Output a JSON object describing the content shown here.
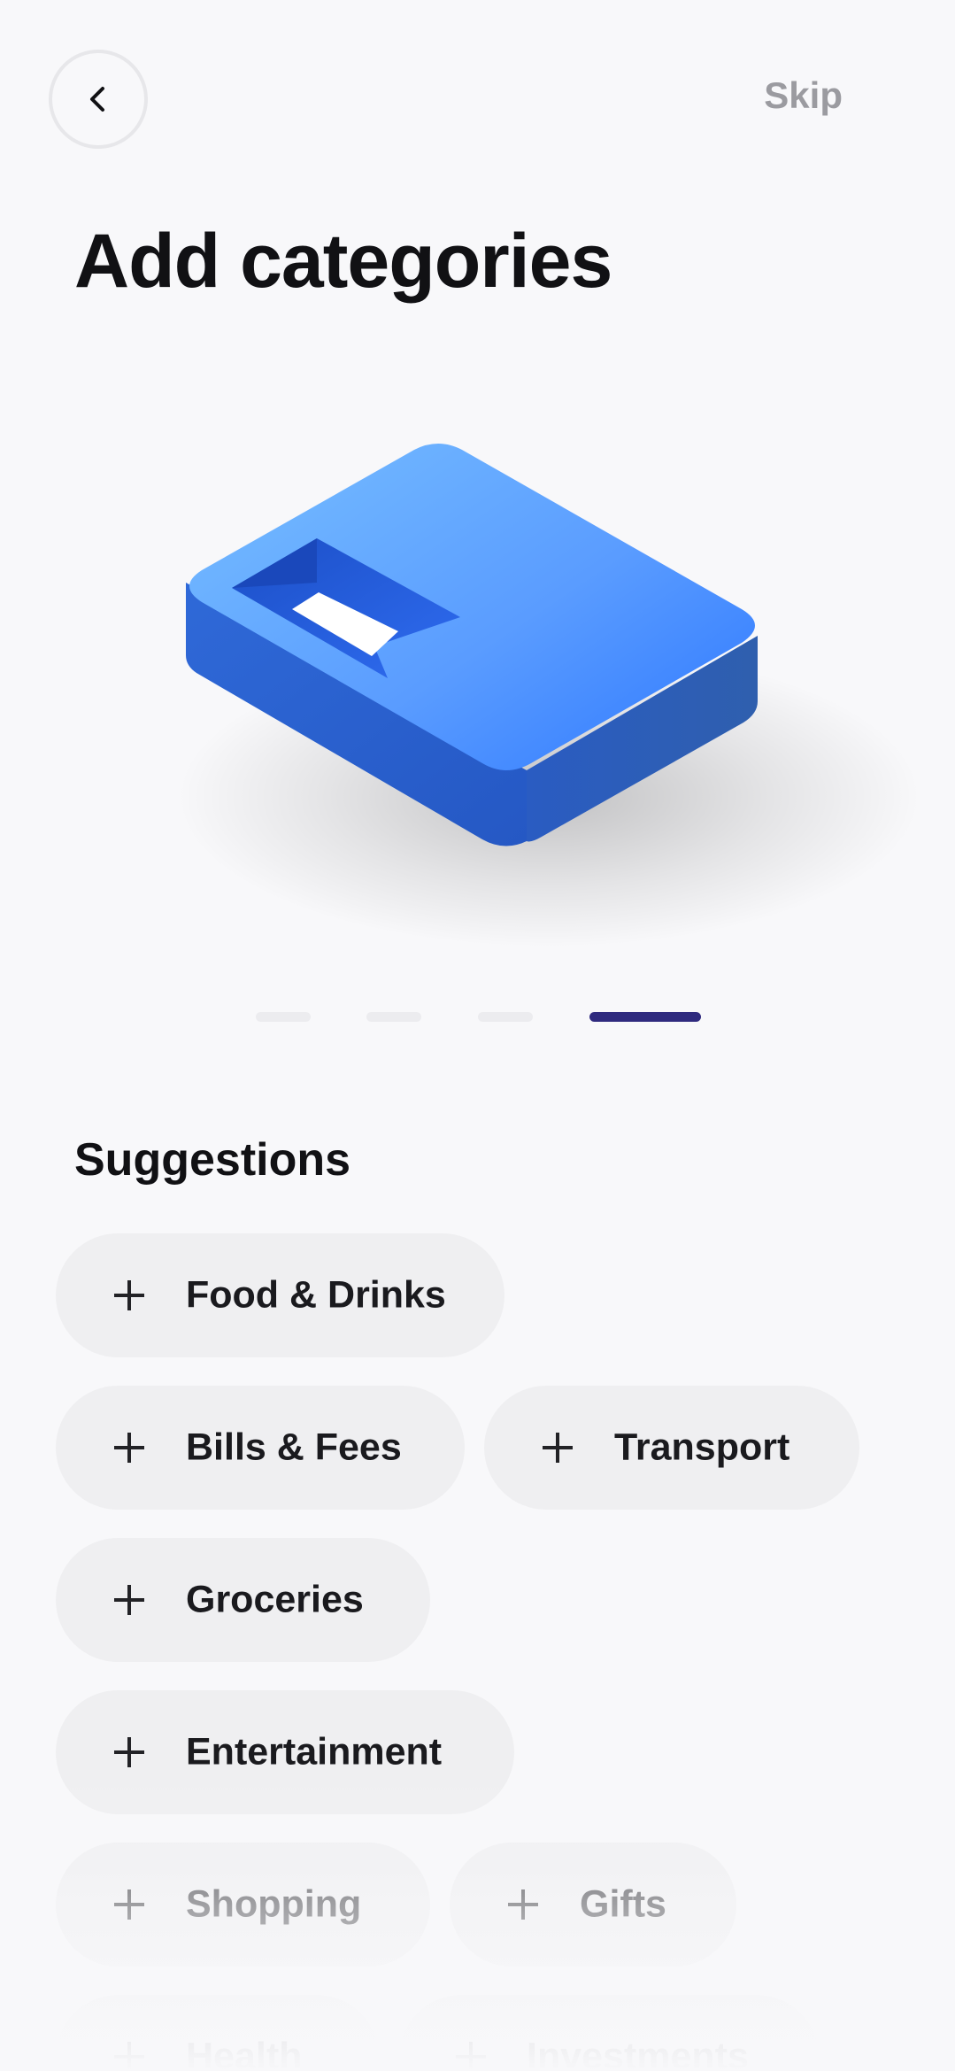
{
  "header": {
    "back_icon": "chevron-left-icon",
    "skip_label": "Skip"
  },
  "page": {
    "title": "Add categories"
  },
  "illustration": {
    "name": "category-card-3d-illustration",
    "primary_color": "#3f7ff0"
  },
  "pager": {
    "total": 4,
    "active_index": 3,
    "active_color": "#2f2a7e"
  },
  "suggestions": {
    "title": "Suggestions",
    "chips": [
      {
        "label": "Food & Drinks"
      },
      {
        "label": "Bills & Fees"
      },
      {
        "label": "Transport"
      },
      {
        "label": "Groceries"
      },
      {
        "label": "Entertainment"
      },
      {
        "label": "Shopping"
      },
      {
        "label": "Gifts"
      },
      {
        "label": "Health"
      },
      {
        "label": "Investments"
      }
    ]
  }
}
